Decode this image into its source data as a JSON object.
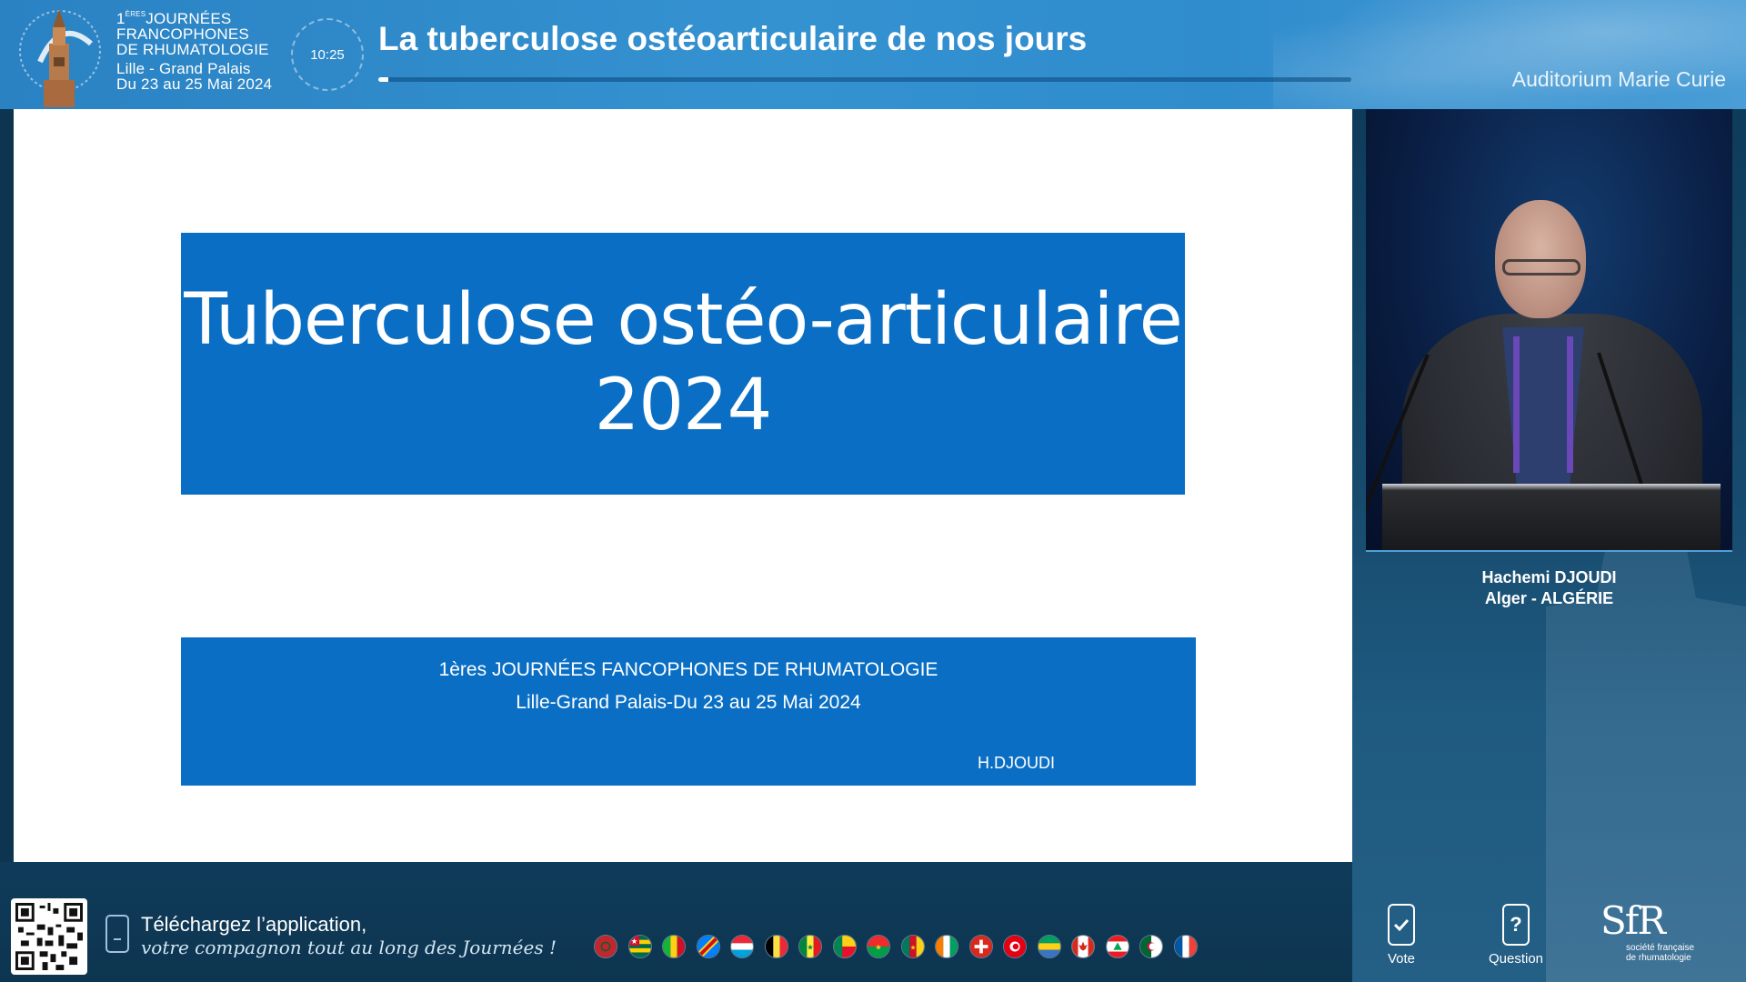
{
  "header": {
    "event_line1": "1",
    "event_sup": "ÈRES",
    "event_line1_rest": "JOURNÉES",
    "event_line2": "FRANCOPHONES",
    "event_line3": "DE RHUMATOLOGIE",
    "event_city": "Lille - Grand Palais",
    "event_dates": "Du 23 au 25 Mai 2024",
    "clock": "10:25",
    "session_title": "La tuberculose ostéoarticulaire de nos jours",
    "progress_fraction": 0.01,
    "room": "Auditorium Marie Curie"
  },
  "slide": {
    "title_line1": "Tuberculose ostéo-articulaire",
    "title_line2": "2024",
    "info_line1": "1ères JOURNÉES FANCOPHONES DE RHUMATOLOGIE",
    "info_line2": "Lille-Grand Palais-Du 23 au 25 Mai 2024",
    "author": "H.DJOUDI",
    "accent_color": "#0a6fc4"
  },
  "speaker": {
    "name": "Hachemi DJOUDI",
    "location": "Alger - ALGÉRIE"
  },
  "footer": {
    "app_line1": "Téléchargez l’application,",
    "app_line2": "votre compagnon tout au long des Journées !",
    "vote_label": "Vote",
    "question_label": "Question",
    "question_glyph": "?",
    "logo_text": "SfR",
    "logo_sub_line1": "société française",
    "logo_sub_line2": "de rhumatologie",
    "flags": [
      "morocco-flag",
      "togo-flag",
      "mali-flag",
      "dr-congo-flag",
      "luxembourg-flag",
      "belgium-flag",
      "senegal-flag",
      "benin-flag",
      "burkina-faso-flag",
      "cameroon-flag",
      "ivory-coast-flag",
      "switzerland-flag",
      "tunisia-flag",
      "gabon-flag",
      "canada-flag",
      "lebanon-flag",
      "algeria-flag",
      "france-flag"
    ]
  }
}
